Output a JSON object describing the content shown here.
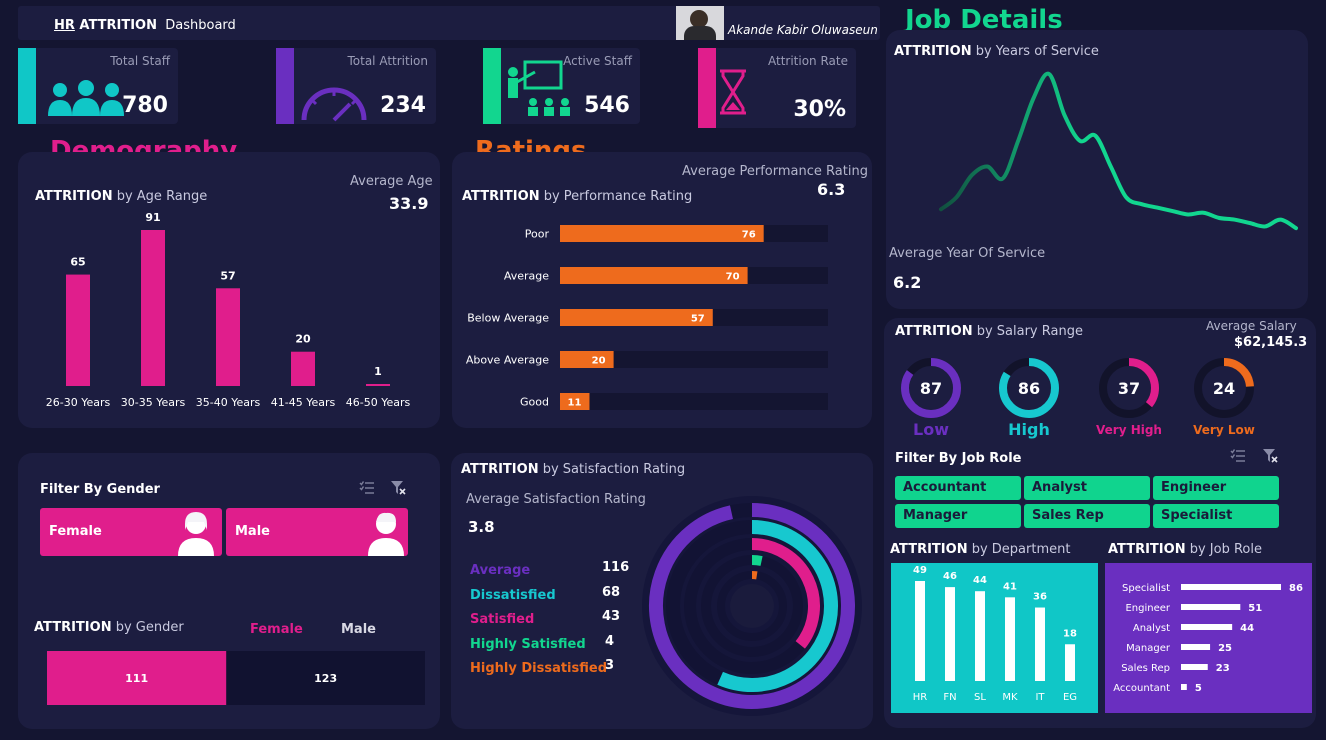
{
  "header": {
    "title_prefix": "HR",
    "title_bold": " ATTRITION",
    "title_rest": "Dashboard",
    "author": "Akande Kabir Oluwaseun"
  },
  "kpis": [
    {
      "label": "Total Staff",
      "value": "780",
      "color": "#10c7c7",
      "icon": "people-icon"
    },
    {
      "label": "Total Attrition",
      "value": "234",
      "color": "#6a2fc0",
      "icon": "speedometer-icon"
    },
    {
      "label": "Active Staff",
      "value": "546",
      "color": "#12d68f",
      "icon": "teacher-icon"
    },
    {
      "label": "Attrition Rate",
      "value": "30%",
      "color": "#e01e8c",
      "icon": "hourglass-icon"
    }
  ],
  "sections": {
    "demography": "Demography",
    "ratings": "Ratings",
    "job_details": "Job Details"
  },
  "age": {
    "title_bold": "ATTRITION",
    "title_rest": " by Age Range",
    "avg_label": "Average Age",
    "avg_value": "33.9",
    "chart_data": {
      "type": "bar",
      "categories": [
        "26-30 Years",
        "30-35 Years",
        "35-40 Years",
        "41-45 Years",
        "46-50 Years"
      ],
      "values": [
        65,
        91,
        57,
        20,
        1
      ]
    }
  },
  "performance": {
    "title_bold": "ATTRITION",
    "title_rest": " by Performance Rating",
    "avg_label": "Average Performance Rating",
    "avg_value": "6.3",
    "chart_data": {
      "type": "bar",
      "categories": [
        "Poor",
        "Average",
        "Below Average",
        "Above Average",
        "Good"
      ],
      "values": [
        76,
        70,
        57,
        20,
        11
      ]
    }
  },
  "years": {
    "title_bold": "ATTRITION",
    "title_rest": " by Years of Service",
    "avg_label": "Average Year Of Service",
    "avg_value": "6.2",
    "chart_data": {
      "type": "line",
      "values": [
        15,
        22,
        35,
        40,
        33,
        55,
        80,
        94,
        70,
        55,
        58,
        40,
        22,
        18,
        16,
        14,
        12,
        13,
        10,
        9,
        7,
        5,
        9,
        4
      ]
    }
  },
  "salary": {
    "title_bold": "ATTRITION",
    "title_rest": " by Salary Range",
    "avg_label": "Average Salary",
    "avg_value": "$62,145.3",
    "rings": [
      {
        "value": "87",
        "label": "Low",
        "color": "#6a2fc0",
        "fraction": 0.85
      },
      {
        "value": "86",
        "label": "High",
        "color": "#17c8cf",
        "fraction": 0.84
      },
      {
        "value": "37",
        "label": "Very High",
        "color": "#e01e8c",
        "fraction": 0.36
      },
      {
        "value": "24",
        "label": "Very Low",
        "color": "#ee6b1d",
        "fraction": 0.24
      }
    ]
  },
  "job_filter": {
    "title": "Filter By Job Role",
    "roles": [
      "Accountant",
      "Analyst",
      "Engineer",
      "Manager",
      "Sales Rep",
      "Specialist"
    ]
  },
  "gender_filter": {
    "title": "Filter By Gender",
    "female": "Female",
    "male": "Male"
  },
  "gender": {
    "title_bold": "ATTRITION",
    "title_rest": " by Gender",
    "legend_female": "Female",
    "legend_male": "Male",
    "chart_data": {
      "type": "bar",
      "categories": [
        "Female",
        "Male"
      ],
      "values": [
        111,
        123
      ]
    }
  },
  "satisfaction": {
    "title_bold": "ATTRITION",
    "title_rest": " by Satisfaction Rating",
    "avg_label": "Average Satisfaction Rating",
    "avg_value": "3.8",
    "chart_data": {
      "type": "pie",
      "categories": [
        "Average",
        "Dissatisfied",
        "Satisfied",
        "Highly Satisfied",
        "Highly Dissatisfied"
      ],
      "values": [
        116,
        68,
        43,
        4,
        3
      ],
      "colors": [
        "#6a2fc0",
        "#17c8cf",
        "#e01e8c",
        "#12d68f",
        "#ee6b1d"
      ]
    }
  },
  "department": {
    "title_bold": "ATTRITION",
    "title_rest": " by Department",
    "chart_data": {
      "type": "bar",
      "categories": [
        "HR",
        "FN",
        "SL",
        "MK",
        "IT",
        "EG"
      ],
      "values": [
        49,
        46,
        44,
        41,
        36,
        18
      ]
    }
  },
  "jobrole": {
    "title_bold": "ATTRITION",
    "title_rest": " by Job Role",
    "chart_data": {
      "type": "bar",
      "categories": [
        "Specialist",
        "Engineer",
        "Analyst",
        "Manager",
        "Sales Rep",
        "Accountant"
      ],
      "values": [
        86,
        51,
        44,
        25,
        23,
        5
      ]
    }
  }
}
